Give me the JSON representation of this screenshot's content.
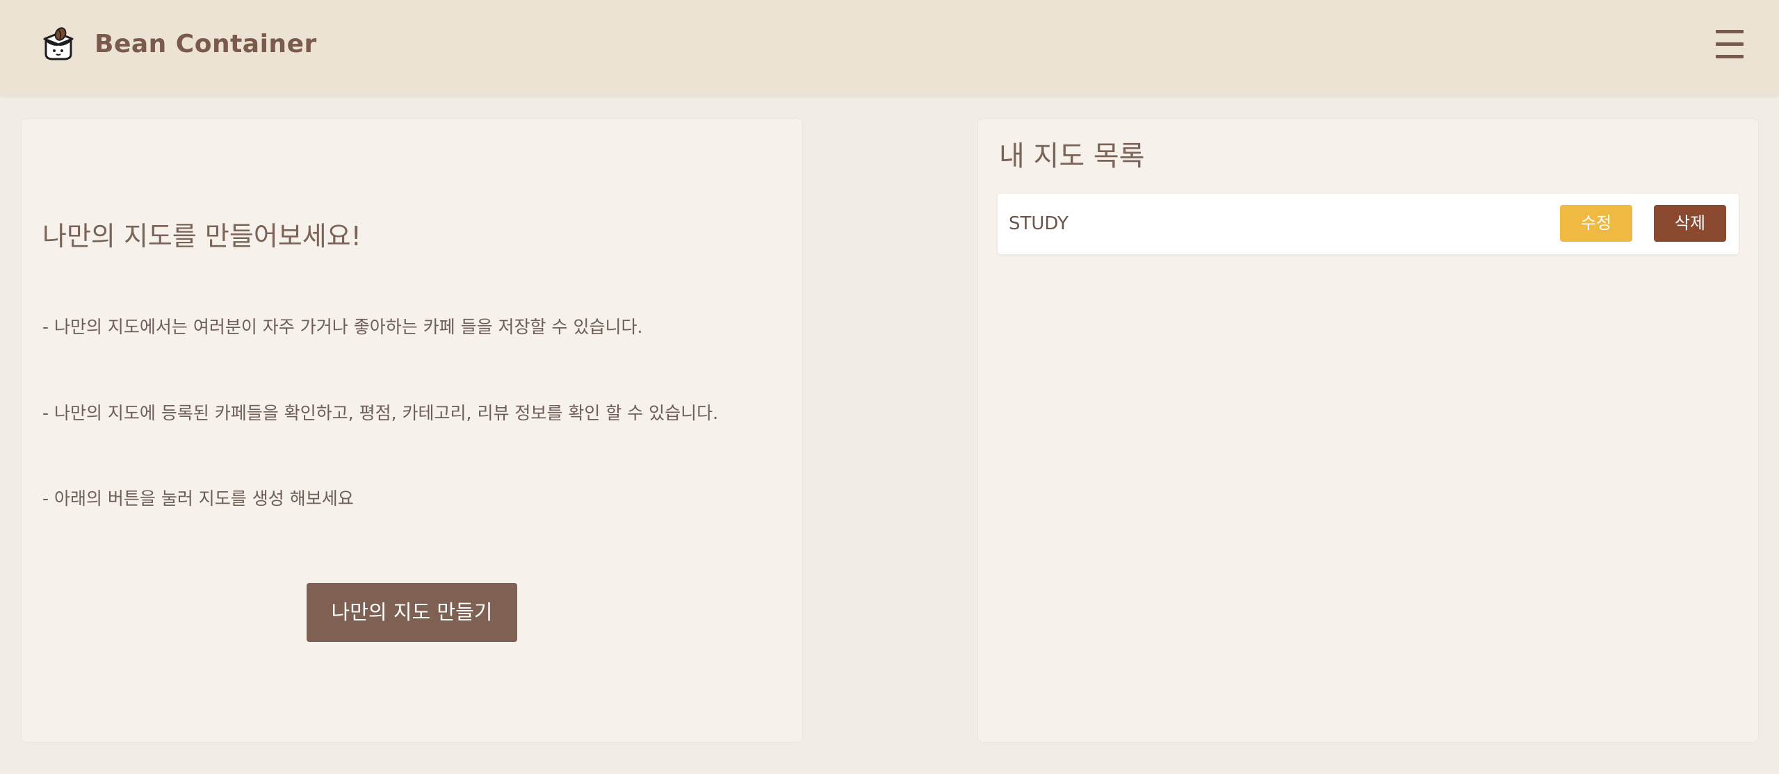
{
  "header": {
    "brand": "Bean Container",
    "logo_icon": "bean-box-icon",
    "menu_icon": "hamburger-menu-icon"
  },
  "intro": {
    "title": "나만의 지도를 만들어보세요!",
    "lines": [
      "- 나만의 지도에서는 여러분이 자주 가거나 좋아하는 카페 들을 저장할 수 있습니다.",
      "- 나만의 지도에 등록된 카페들을 확인하고, 평점, 카테고리, 리뷰 정보를 확인 할 수 있습니다.",
      "- 아래의 버튼을 눌러 지도를 생성 해보세요"
    ],
    "create_button": "나만의 지도 만들기"
  },
  "my_maps": {
    "title": "내 지도 목록",
    "items": [
      {
        "name": "STUDY",
        "edit_label": "수정",
        "delete_label": "삭제"
      }
    ]
  },
  "colors": {
    "header_bg": "#ede3d5",
    "page_bg": "#f1ede6",
    "card_bg": "#f6f1ea",
    "primary_brown": "#7e6153",
    "edit_yellow": "#f0b942",
    "delete_brown": "#8b4a30"
  }
}
